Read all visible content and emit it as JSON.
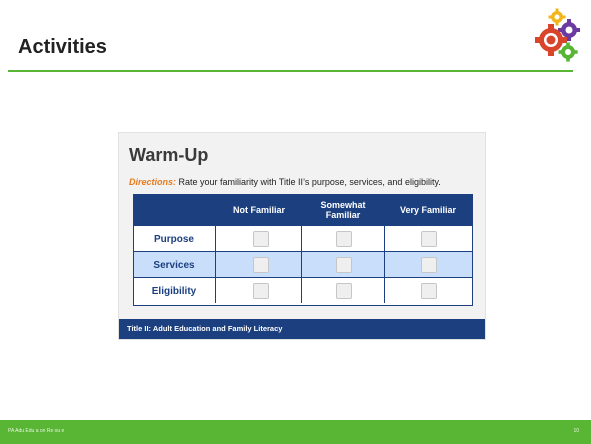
{
  "slide": {
    "title": "Activities",
    "footer_text": "PA Adu  Edu  a  on Re  ou  e",
    "page_number": "10",
    "accent_color": "#59b534"
  },
  "logo": {
    "icon": "gears-logo-icon"
  },
  "card": {
    "heading": "Warm-Up",
    "directions_label": "Directions:",
    "directions_text": " Rate your familiarity with Title II’s purpose, services, and eligibility.",
    "columns": [
      "Not Familiar",
      "Somewhat Familiar",
      "Very Familiar"
    ],
    "rows": [
      {
        "label": "Purpose",
        "highlighted": false
      },
      {
        "label": "Services",
        "highlighted": true
      },
      {
        "label": "Eligibility",
        "highlighted": false
      }
    ],
    "footer": "Title II: Adult Education and Family Literacy",
    "header_color": "#1b3f7f",
    "highlight_color": "#c8defb"
  }
}
